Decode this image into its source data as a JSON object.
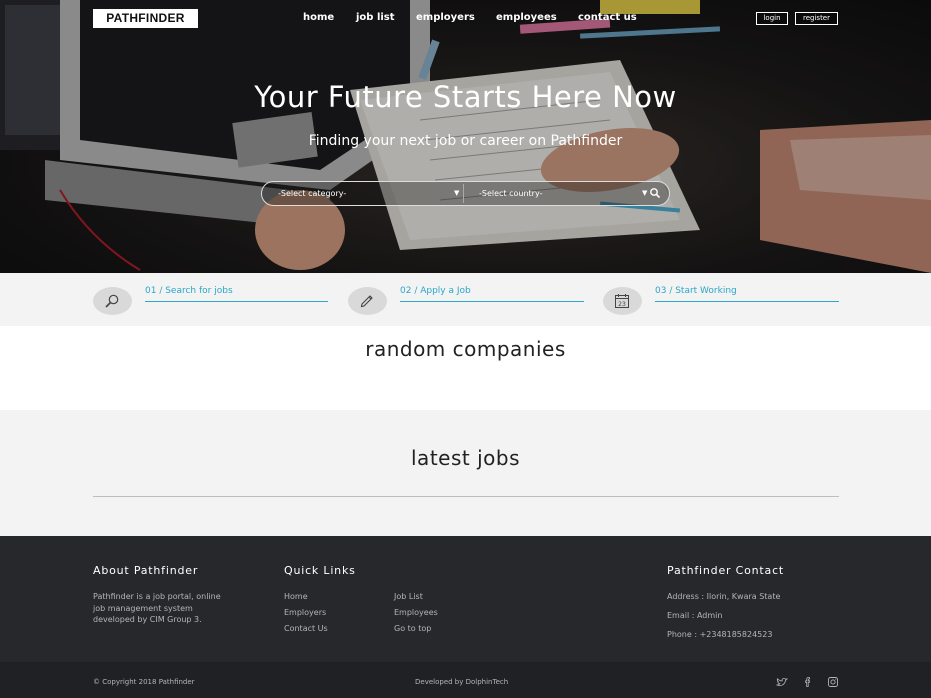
{
  "brand": {
    "logo": "PATHFINDER"
  },
  "nav": {
    "items": [
      "home",
      "job list",
      "employers",
      "employees",
      "contact us"
    ]
  },
  "auth": {
    "login": "login",
    "register": "register"
  },
  "hero": {
    "title": "Your Future Starts Here Now",
    "subtitle": "Finding your next job or career on Pathfinder",
    "category_select": "-Select category-",
    "country_select": "-Select country-"
  },
  "steps": [
    {
      "label": "01 / Search for jobs",
      "icon": "magnifier-icon"
    },
    {
      "label": "02 / Apply a Job",
      "icon": "pencil-icon"
    },
    {
      "label": "03 / Start Working",
      "icon": "calendar-icon",
      "icon_text": "23"
    }
  ],
  "sections": {
    "companies_title": "random companies",
    "latest_title": "latest jobs"
  },
  "footer": {
    "about": {
      "title": "About Pathfinder",
      "lines": [
        "Pathfinder is a job portal, online",
        "job management system",
        "developed by CIM Group 3."
      ]
    },
    "quick_links": {
      "title": "Quick Links",
      "col1": [
        "Home",
        "Employers",
        "Contact Us"
      ],
      "col2": [
        "Job List",
        "Employees",
        "Go to top"
      ]
    },
    "contact": {
      "title": "Pathfinder Contact",
      "address": "Address : Ilorin, Kwara State",
      "email": "Email : Admin",
      "phone": "Phone : +2348185824523"
    },
    "copyright": "© Copyright 2018 Pathfinder",
    "developer": "Developed by DolphinTech",
    "social_icons": [
      "twitter-icon",
      "facebook-icon",
      "instagram-icon"
    ]
  },
  "colors": {
    "accent": "#2aa7c9",
    "footer_bg": "#27282c",
    "section_bg": "#f3f3f3"
  }
}
